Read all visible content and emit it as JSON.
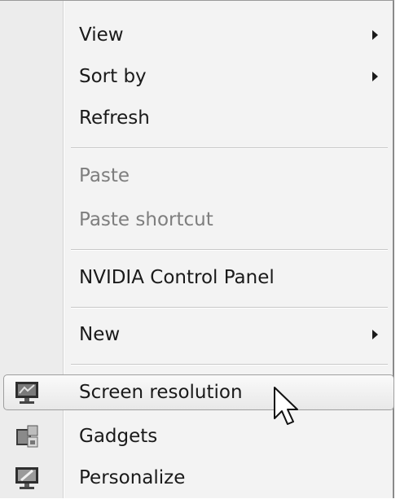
{
  "menu": {
    "items": [
      {
        "label": "View",
        "submenu": true,
        "enabled": true
      },
      {
        "label": "Sort by",
        "submenu": true,
        "enabled": true
      },
      {
        "label": "Refresh",
        "submenu": false,
        "enabled": true
      },
      {
        "label": "Paste",
        "submenu": false,
        "enabled": false
      },
      {
        "label": "Paste shortcut",
        "submenu": false,
        "enabled": false
      },
      {
        "label": "NVIDIA Control Panel",
        "submenu": false,
        "enabled": true
      },
      {
        "label": "New",
        "submenu": true,
        "enabled": true
      },
      {
        "label": "Screen resolution",
        "submenu": false,
        "enabled": true,
        "highlighted": true,
        "icon": "monitor-icon"
      },
      {
        "label": "Gadgets",
        "submenu": false,
        "enabled": true,
        "icon": "gadgets-icon"
      },
      {
        "label": "Personalize",
        "submenu": false,
        "enabled": true,
        "icon": "personalize-icon"
      }
    ]
  },
  "cursor": {
    "icon": "mouse-pointer-icon"
  }
}
